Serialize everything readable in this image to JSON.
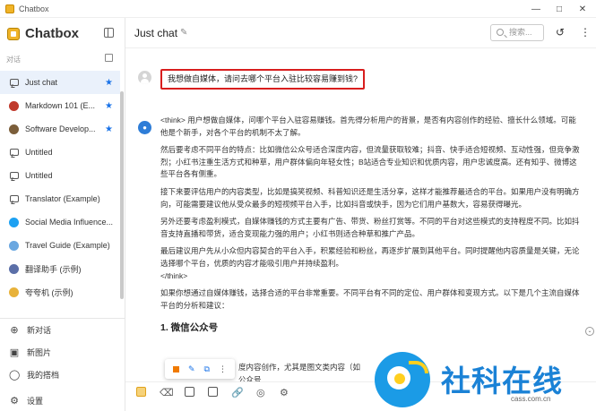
{
  "window": {
    "title": "Chatbox"
  },
  "sidebar": {
    "brand": "Chatbox",
    "section_label": "对话",
    "items": [
      {
        "label": "Just chat",
        "icon": "chat-bubble-icon",
        "starred": true,
        "active": true
      },
      {
        "label": "Markdown 101 (E...",
        "icon": "avatar-markdown",
        "starred": true,
        "active": false,
        "color": "#c0392b"
      },
      {
        "label": "Software Develop...",
        "icon": "avatar-software",
        "starred": true,
        "active": false,
        "color": "#7b5e3a"
      },
      {
        "label": "Untitled",
        "icon": "chat-bubble-icon",
        "starred": false,
        "active": false
      },
      {
        "label": "Untitled",
        "icon": "chat-bubble-icon",
        "starred": false,
        "active": false
      },
      {
        "label": "Translator (Example)",
        "icon": "chat-bubble-icon",
        "starred": false,
        "active": false
      },
      {
        "label": "Social Media Influence...",
        "icon": "avatar-twitter",
        "starred": false,
        "active": false,
        "color": "#1da1f2"
      },
      {
        "label": "Travel Guide (Example)",
        "icon": "avatar-travel",
        "starred": false,
        "active": false,
        "color": "#6aa7e0"
      },
      {
        "label": "翻译助手 (示例)",
        "icon": "avatar-translate",
        "starred": false,
        "active": false,
        "color": "#5b6fa8"
      },
      {
        "label": "夸夸机 (示例)",
        "icon": "avatar-praise",
        "starred": false,
        "active": false,
        "color": "#e8b23a"
      }
    ],
    "bottom": [
      {
        "label": "新对话",
        "icon": "plus-circle-icon"
      },
      {
        "label": "新图片",
        "icon": "image-icon"
      },
      {
        "label": "我的搭档",
        "icon": "partner-icon"
      },
      {
        "label": "设置",
        "icon": "gear-icon"
      }
    ]
  },
  "header": {
    "title": "Just chat",
    "search_placeholder": "搜索..."
  },
  "messages": {
    "user": "我想做自媒体，请问去哪个平台入驻比较容易赚到钱?",
    "assistant": {
      "paragraphs": [
        "<think> 用户想做自媒体，问哪个平台入驻容易赚钱。首先得分析用户的背景，是否有内容创作的经验、擅长什么领域。可能他是个新手，对各个平台的机制不太了解。",
        "然后要考虑不同平台的特点：比如微信公众号适合深度内容，但流量获取较难；抖音、快手适合短视频、互动性强，但竞争激烈；小红书注重生活方式和种草，用户群体偏向年轻女性；B站适合专业知识和优质内容，用户忠诚度高。还有知乎、微博这些平台各有侧重。",
        "接下来要评估用户的内容类型，比如是搞笑视频、科普知识还是生活分享，这样才能推荐最适合的平台。如果用户没有明确方向，可能需要建议他从受众最多的短视频平台入手，比如抖音或快手，因为它们用户基数大，容易获得曝光。",
        "另外还要考虑盈利模式，自媒体赚钱的方式主要有广告、带货、粉丝打赏等。不同的平台对这些模式的支持程度不同。比如抖音支持直播和带货，适合变现能力强的用户；小红书则适合种草和推广产品。",
        "最后建议用户先从小众但内容契合的平台入手，积累经验和粉丝，再逐步扩展到其他平台。同时提醒他内容质量是关键，无论选择哪个平台，优质的内容才能吸引用户并持续盈利。",
        "</think>",
        "如果你想通过自媒体赚钱，选择合适的平台非常重要。不同平台有不同的定位、用户群体和变现方式。以下是几个主流自媒体平台的分析和建议："
      ],
      "heading": "1. 微信公众号",
      "partial_line": "度内容创作，尤其是图文类内容（如",
      "partial_line2": "公众号"
    }
  },
  "watermark": {
    "text": "社科在线",
    "url": "cass.com.cn"
  }
}
